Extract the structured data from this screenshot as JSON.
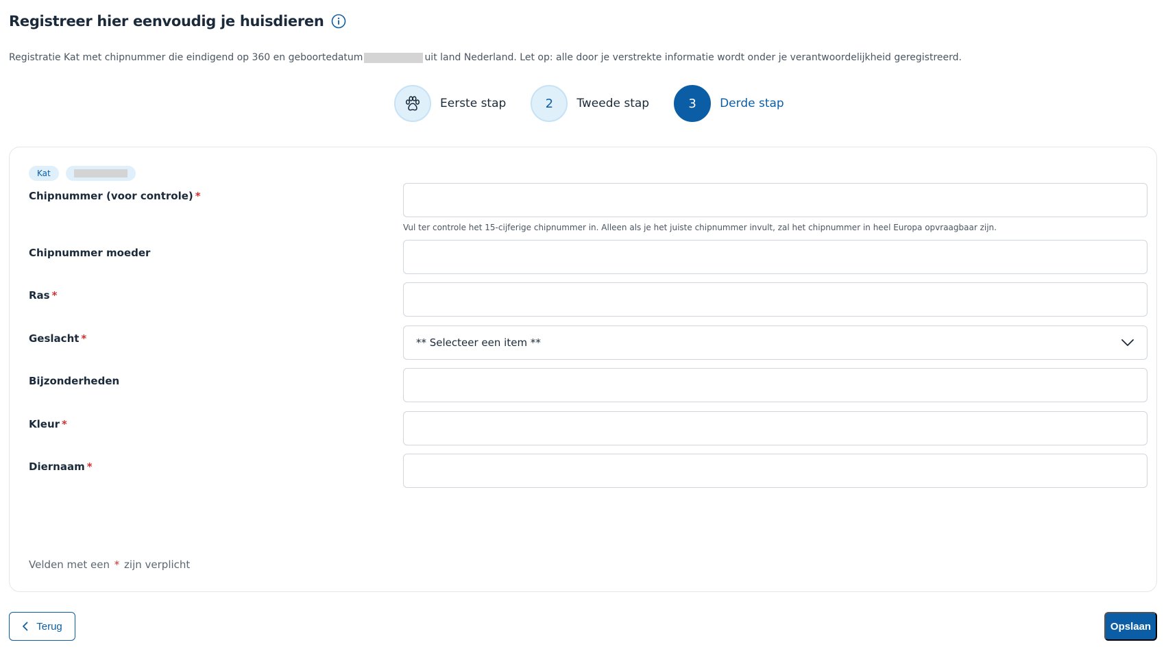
{
  "header": {
    "title": "Registreer hier eenvoudig je huisdieren",
    "info_icon": "info-icon"
  },
  "intro": {
    "before": "Registratie Kat met chipnummer die eindigend op 360 en geboortedatum",
    "after": "uit land Nederland. Let op: alle door je verstrekte informatie wordt onder je verantwoordelijkheid geregistreerd."
  },
  "stepper": {
    "steps": [
      {
        "label": "Eerste stap",
        "icon": "paw-icon",
        "state": "done"
      },
      {
        "label": "Tweede stap",
        "number": "2",
        "state": "done"
      },
      {
        "label": "Derde stap",
        "number": "3",
        "state": "active"
      }
    ]
  },
  "chips": {
    "species": "Kat"
  },
  "form": {
    "required_marker": "*",
    "chipnummer": {
      "label": "Chipnummer (voor controle)",
      "value": "",
      "hint": "Vul ter controle het 15-cijferige chipnummer in. Alleen als je het juiste chipnummer invult, zal het chipnummer in heel Europa opvraagbaar zijn."
    },
    "chipnummer_moeder": {
      "label": "Chipnummer moeder",
      "value": ""
    },
    "ras": {
      "label": "Ras",
      "value": ""
    },
    "geslacht": {
      "label": "Geslacht",
      "selected": "** Selecteer een item **"
    },
    "bijzonderheden": {
      "label": "Bijzonderheden",
      "value": ""
    },
    "kleur": {
      "label": "Kleur",
      "value": ""
    },
    "diernaam": {
      "label": "Diernaam",
      "value": ""
    },
    "required_note_before": "Velden met een",
    "required_note_after": "zijn verplicht"
  },
  "footer": {
    "back_label": "Terug",
    "save_label": "Opslaan"
  },
  "colors": {
    "primary": "#0b5ea6",
    "step_light": "#e0f0fb",
    "required": "#d32f2f"
  }
}
